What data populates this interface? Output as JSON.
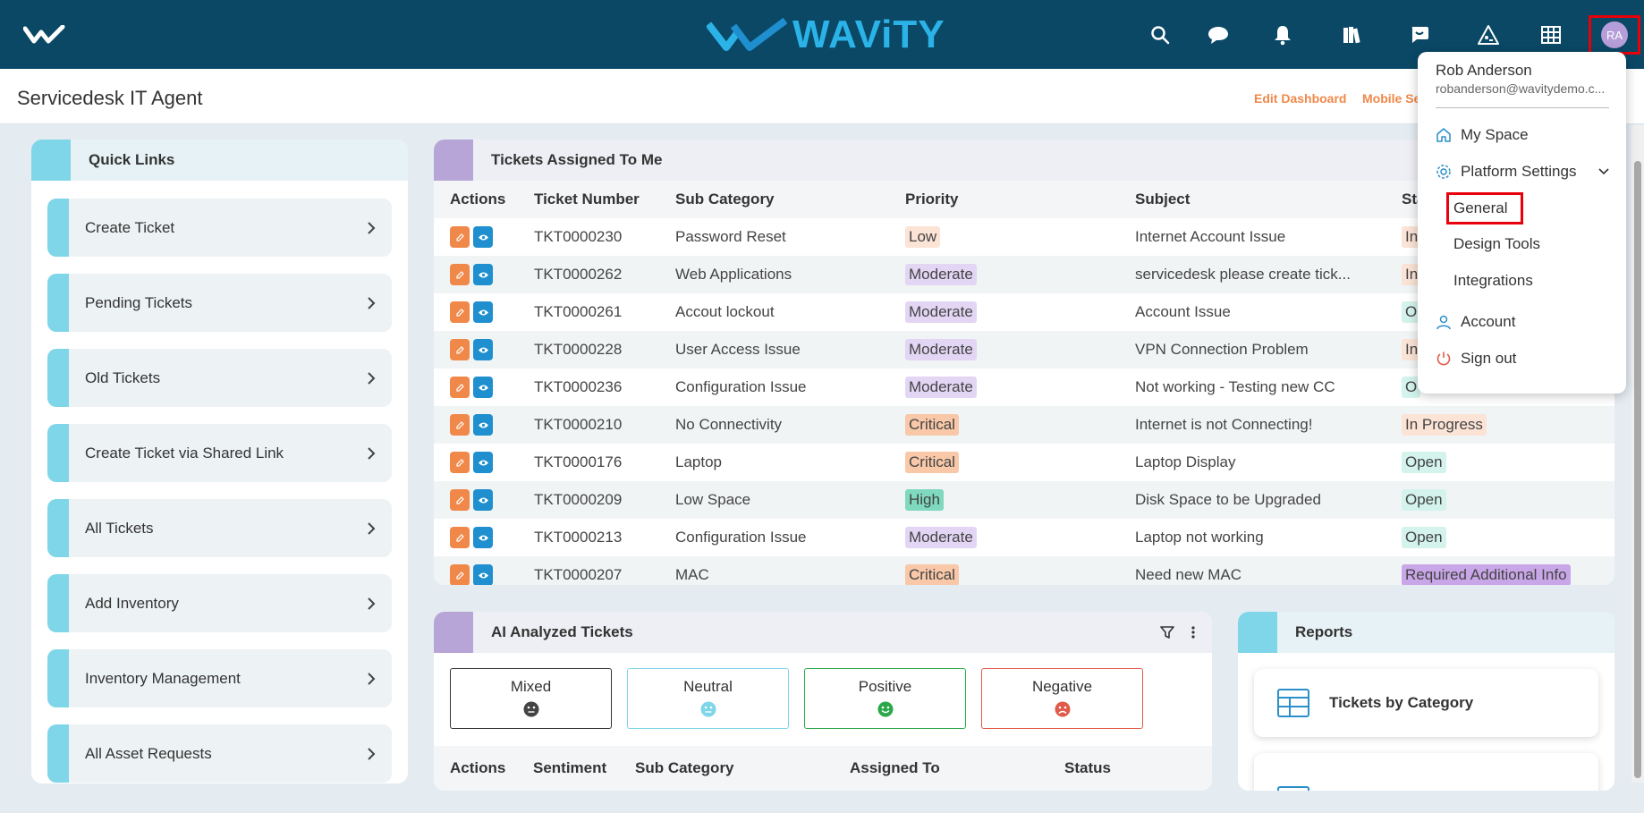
{
  "brand": {
    "name": "WAViTY"
  },
  "user": {
    "initials": "RA",
    "name": "Rob Anderson",
    "email": "robanderson@wavitydemo.c..."
  },
  "header": {
    "title": "Servicedesk IT Agent",
    "edit_dashboard": "Edit Dashboard",
    "mobile_settings": "Mobile Se"
  },
  "quick_links": {
    "title": "Quick Links",
    "items": [
      "Create Ticket",
      "Pending Tickets",
      "Old Tickets",
      "Create Ticket via Shared Link",
      "All Tickets",
      "Add Inventory",
      "Inventory Management",
      "All Asset Requests"
    ]
  },
  "tickets": {
    "title": "Tickets Assigned To Me",
    "columns": [
      "Actions",
      "Ticket Number",
      "Sub Category",
      "Priority",
      "Subject",
      "Sta"
    ],
    "rows": [
      {
        "number": "TKT0000230",
        "sub_category": "Password Reset",
        "priority": "Low",
        "subject": "Internet Account Issue",
        "status": "In"
      },
      {
        "number": "TKT0000262",
        "sub_category": "Web Applications",
        "priority": "Moderate",
        "subject": "servicedesk please create tick...",
        "status": "In"
      },
      {
        "number": "TKT0000261",
        "sub_category": "Accout lockout",
        "priority": "Moderate",
        "subject": "Account Issue",
        "status": "O"
      },
      {
        "number": "TKT0000228",
        "sub_category": "User Access Issue",
        "priority": "Moderate",
        "subject": "VPN Connection Problem",
        "status": "In"
      },
      {
        "number": "TKT0000236",
        "sub_category": "Configuration Issue",
        "priority": "Moderate",
        "subject": "Not working - Testing new CC",
        "status": "O"
      },
      {
        "number": "TKT0000210",
        "sub_category": "No Connectivity",
        "priority": "Critical",
        "subject": "Internet is not Connecting!",
        "status": "In Progress"
      },
      {
        "number": "TKT0000176",
        "sub_category": "Laptop",
        "priority": "Critical",
        "subject": "Laptop Display",
        "status": "Open"
      },
      {
        "number": "TKT0000209",
        "sub_category": "Low Space",
        "priority": "High",
        "subject": "Disk Space to be Upgraded",
        "status": "Open"
      },
      {
        "number": "TKT0000213",
        "sub_category": "Configuration Issue",
        "priority": "Moderate",
        "subject": "Laptop not working",
        "status": "Open"
      },
      {
        "number": "TKT0000207",
        "sub_category": "MAC",
        "priority": "Critical",
        "subject": "Need new MAC",
        "status": "Required Additional Info"
      }
    ]
  },
  "ai": {
    "title": "AI Analyzed Tickets",
    "sentiments": [
      "Mixed",
      "Neutral",
      "Positive",
      "Negative"
    ],
    "columns": [
      "Actions",
      "Sentiment",
      "Sub Category",
      "Assigned To",
      "Status"
    ]
  },
  "reports": {
    "title": "Reports",
    "items": [
      "Tickets by Category"
    ]
  },
  "menu": {
    "my_space": "My Space",
    "platform_settings": "Platform Settings",
    "general": "General",
    "design_tools": "Design Tools",
    "integrations": "Integrations",
    "account": "Account",
    "sign_out": "Sign out"
  },
  "colors": {
    "topbar": "#0a4866",
    "accent_orange": "#f0884a",
    "accent_blue": "#1f8fcf",
    "priority_low": "#fbe3d6",
    "priority_moderate": "#e3d6f5",
    "priority_critical": "#f8c8a8",
    "priority_high": "#7fd9be",
    "status_in_progress": "#fbe3d6",
    "status_open": "#d3f3ec",
    "status_required": "#c9a6e8"
  }
}
